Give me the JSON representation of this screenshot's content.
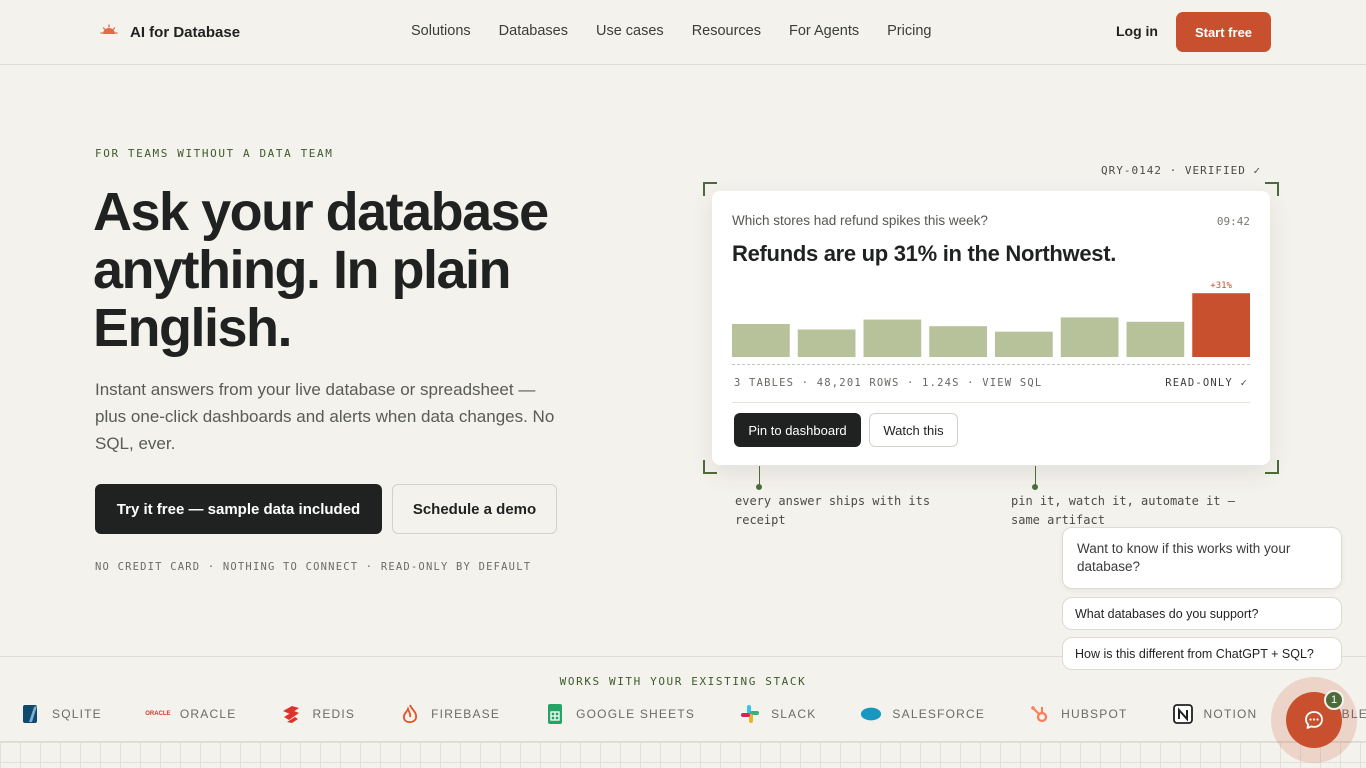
{
  "nav": {
    "brand": "AI for Database",
    "links": [
      "Solutions",
      "Databases",
      "Use cases",
      "Resources",
      "For Agents",
      "Pricing"
    ],
    "login": "Log in",
    "start": "Start free"
  },
  "hero": {
    "eyebrow": "FOR TEAMS WITHOUT A DATA TEAM",
    "headline": "Ask your database anything. In plain English.",
    "subtitle": "Instant answers from your live database or spreadsheet — plus one-click dashboards and alerts when data changes. No SQL, ever.",
    "cta_primary": "Try it free — sample data included",
    "cta_secondary": "Schedule a demo",
    "fineprint": "NO CREDIT CARD · NOTHING TO CONNECT · READ-ONLY BY DEFAULT"
  },
  "card": {
    "badge": "QRY-0142 · VERIFIED ✓",
    "question": "Which stores had refund spikes this week?",
    "time": "09:42",
    "answer": "Refunds are up 31% in the Northwest.",
    "meta": "3 TABLES · 48,201 ROWS · 1.24S · VIEW SQL",
    "readonly": "READ-ONLY ✓",
    "pin": "Pin to dashboard",
    "watch": "Watch this",
    "note_left": "every answer ships with its receipt",
    "note_right": "pin it, watch it, automate it — same artifact"
  },
  "chart_data": {
    "type": "bar",
    "values": [
      30,
      25,
      34,
      28,
      23,
      36,
      32,
      58
    ],
    "highlight_index": 7,
    "highlight_label": "+31%",
    "colors": {
      "normal": "#b8c29a",
      "highlight": "#c9502e"
    }
  },
  "chat": {
    "prompt": "Want to know if this works with your database?",
    "suggestions": [
      "What databases do you support?",
      "How is this different from ChatGPT + SQL?"
    ],
    "badge": "1"
  },
  "stack": {
    "title": "WORKS WITH YOUR EXISTING STACK",
    "oracle_mark": "ORACLE",
    "items": [
      "SQLITE",
      "ORACLE",
      "REDIS",
      "FIREBASE",
      "GOOGLE SHEETS",
      "SLACK",
      "SALESFORCE",
      "HUBSPOT",
      "NOTION",
      "AIRTABLE"
    ]
  },
  "colors": {
    "accent": "#c9502e",
    "dark": "#1f2220",
    "green": "#4d6b3a",
    "background": "#f4f2ec"
  }
}
